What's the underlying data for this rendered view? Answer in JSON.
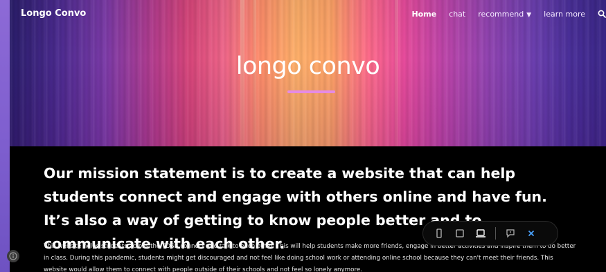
{
  "site": {
    "brand": "Longo Convo",
    "nav": [
      {
        "label": "Home",
        "active": true
      },
      {
        "label": "chat",
        "active": false
      },
      {
        "label": "recommend",
        "active": false,
        "has_dropdown": true
      },
      {
        "label": "learn more",
        "active": false
      }
    ],
    "search_icon": "search-icon"
  },
  "hero": {
    "title": "longo convo",
    "colors": {
      "underline": "#e58be5"
    }
  },
  "main": {
    "mission": "Our mission statement is to create a website that can help students connect and engage with others online and have fun. It’s also a way of getting to know people better and to communicate with each other.",
    "body": "This website helps students across the TDSB connect and talk to each other. This will help students make more friends, engage in better activities and inspire them to do better in class. During this pandemic, students might get discouraged and not feel like doing school work or attending online school because they can't meet their friends. This website would allow them to connect with people outside of their schools and not feel so lonely anymore."
  },
  "preview_toolbar": {
    "buttons": [
      "phone-icon",
      "tablet-icon",
      "laptop-icon",
      "comment-icon",
      "close-icon"
    ],
    "active": "laptop-icon"
  }
}
